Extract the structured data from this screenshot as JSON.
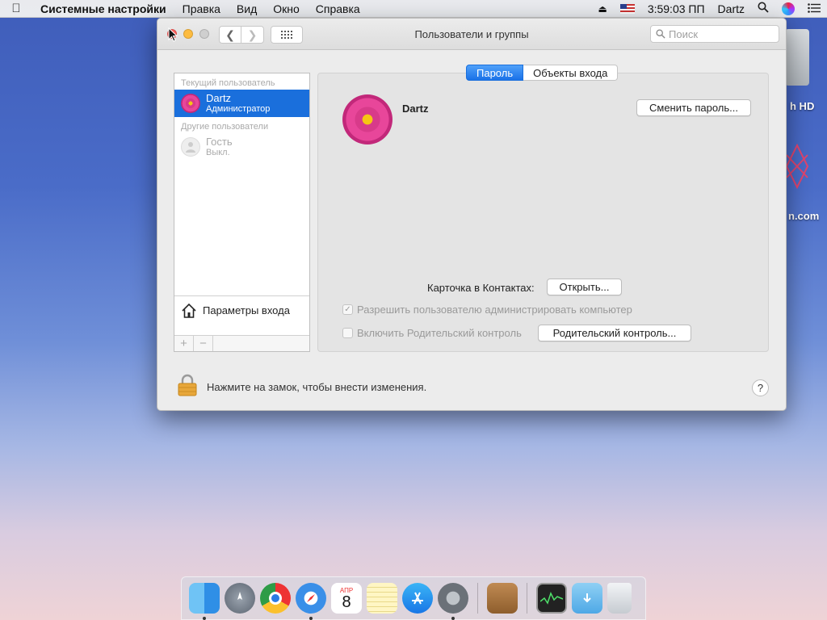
{
  "menubar": {
    "app": "Системные настройки",
    "items": [
      "Правка",
      "Вид",
      "Окно",
      "Справка"
    ],
    "clock": "3:59:03 ПП",
    "user": "Dartz"
  },
  "desktop": {
    "hd_label": "h HD",
    "site_label": "n.com"
  },
  "window": {
    "title": "Пользователи и группы",
    "search_placeholder": "Поиск"
  },
  "sidebar": {
    "current_header": "Текущий пользователь",
    "current_user": {
      "name": "Dartz",
      "role": "Администратор"
    },
    "other_header": "Другие пользователи",
    "guest": {
      "name": "Гость",
      "status": "Выкл."
    },
    "login_options": "Параметры входа",
    "add": "+",
    "remove": "−"
  },
  "tabs": {
    "password": "Пароль",
    "login_items": "Объекты входа"
  },
  "main": {
    "user_name": "Dartz",
    "change_password": "Сменить пароль...",
    "contacts_label": "Карточка в Контактах:",
    "open_button": "Открыть...",
    "allow_admin": "Разрешить пользователю администрировать компьютер",
    "allow_admin_checked": true,
    "parental_enable": "Включить Родительский контроль",
    "parental_checked": false,
    "parental_button": "Родительский контроль..."
  },
  "footer": {
    "lock_text": "Нажмите на замок, чтобы внести изменения.",
    "help": "?"
  },
  "dock": {
    "calendar_month": "АПР",
    "calendar_day": "8",
    "items": [
      "finder-icon",
      "launchpad-icon",
      "chrome-icon",
      "safari-icon",
      "calendar-icon",
      "notes-icon",
      "app-store-icon",
      "system-preferences-icon",
      "contacts-icon",
      "activity-monitor-icon",
      "downloads-icon",
      "trash-icon"
    ]
  }
}
